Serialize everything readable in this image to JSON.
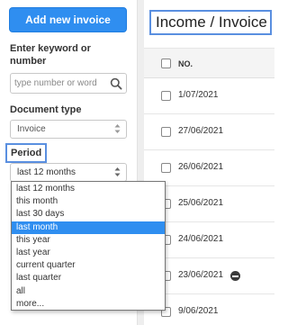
{
  "sidebar": {
    "add_button": "Add new invoice",
    "keyword_label": "Enter keyword or number",
    "search_placeholder": "type number or word",
    "doctype_label": "Document type",
    "doctype_value": "Invoice",
    "period_label": "Period",
    "period_value": "last 12 months",
    "period_options": [
      "last 12 months",
      "this month",
      "last 30 days",
      "last month",
      "this year",
      "last year",
      "current quarter",
      "last quarter",
      "all",
      "more..."
    ],
    "highlighted_option": "last month"
  },
  "main": {
    "title": "Income / Invoice",
    "column_header": "NO.",
    "rows": [
      {
        "date": "1/07/2021"
      },
      {
        "date": "27/06/2021"
      },
      {
        "date": "26/06/2021"
      },
      {
        "date": "25/06/2021"
      },
      {
        "date": "24/06/2021"
      },
      {
        "date": "23/06/2021",
        "status_icon": "minus-circle-icon"
      },
      {
        "date": "9/06/2021"
      }
    ]
  },
  "colors": {
    "accent": "#2f8ef0",
    "highlight_border": "#5a8fe0",
    "row_header_bg": "#f4f4f4"
  }
}
